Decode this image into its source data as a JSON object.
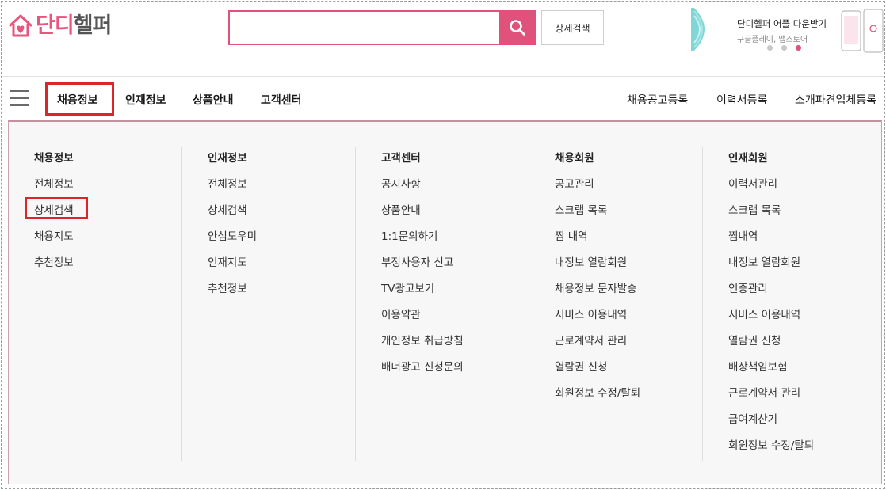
{
  "header": {
    "logo": {
      "part1": "단디",
      "part2": "헬퍼"
    },
    "search": {
      "value": "",
      "placeholder": ""
    },
    "detail_search_label": "상세검색",
    "promo": {
      "title": "단디헬퍼 어플 다운받기",
      "subtitle": "구글플레이, 앱스토어",
      "dots": 3,
      "active_dot": 2
    }
  },
  "nav": {
    "items": [
      "채용정보",
      "인재정보",
      "상품안내",
      "고객센터"
    ],
    "active_index": 0,
    "right_items": [
      "채용공고등록",
      "이력서등록",
      "소개파견업체등록"
    ]
  },
  "menu": {
    "columns": [
      {
        "title": "채용정보",
        "items": [
          "전체정보",
          "상세검색",
          "채용지도",
          "추천정보"
        ]
      },
      {
        "title": "인재정보",
        "items": [
          "전체정보",
          "상세검색",
          "안심도우미",
          "인재지도",
          "추천정보"
        ]
      },
      {
        "title": "고객센터",
        "items": [
          "공지사항",
          "상품안내",
          "1:1문의하기",
          "부정사용자 신고",
          "TV광고보기",
          "이용약관",
          "개인정보 취급방침",
          "배너광고 신청문의"
        ]
      },
      {
        "title": "채용회원",
        "items": [
          "공고관리",
          "스크랩 목록",
          "찜 내역",
          "내정보 열람회원",
          "채용정보 문자발송",
          "서비스 이용내역",
          "근로계약서 관리",
          "열람권 신청",
          "회원정보 수정/탈퇴"
        ]
      },
      {
        "title": "인재회원",
        "items": [
          "이력서관리",
          "스크랩 목록",
          "찜내역",
          "내정보 열람회원",
          "인증관리",
          "서비스 이용내역",
          "열람권 신청",
          "배상책임보험",
          "근로계약서 관리",
          "급여계산기",
          "회원정보 수정/탈퇴"
        ]
      }
    ],
    "highlighted": {
      "column": 0,
      "item": 1
    }
  },
  "colors": {
    "accent": "#e0517b",
    "highlight_border": "#d9262b",
    "menu_bg": "#f7f7f7"
  }
}
